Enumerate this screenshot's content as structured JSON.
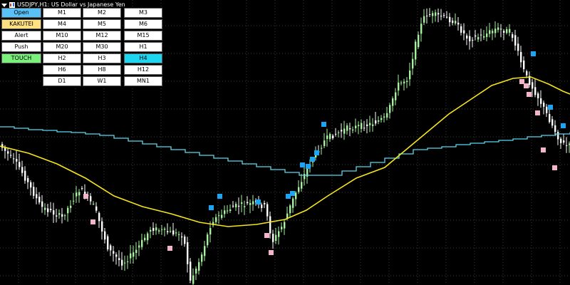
{
  "window": {
    "title": "USDJPY,H1: US Dollar vs Japanese Yen"
  },
  "panel": {
    "left_buttons": [
      {
        "label": "Open",
        "style": "open"
      },
      {
        "label": "KAKUTEI",
        "style": "kakutei"
      },
      {
        "label": "Alert",
        "style": "plain"
      },
      {
        "label": "Push",
        "style": "plain"
      },
      {
        "label": "TOUCH",
        "style": "touch"
      }
    ],
    "timeframes": [
      [
        "M1",
        "M2",
        "M3"
      ],
      [
        "M4",
        "M5",
        "M6"
      ],
      [
        "M10",
        "M12",
        "M15"
      ],
      [
        "M20",
        "M30",
        "H1"
      ],
      [
        "H2",
        "H3",
        "H4"
      ],
      [
        "H6",
        "H8",
        "H12"
      ],
      [
        "D1",
        "W1",
        "MN1"
      ]
    ],
    "active_timeframe": "H4"
  },
  "colors": {
    "background": "#000000",
    "grid": "#3a3a3a",
    "bull_candle": "#a7f0a0",
    "bear_candle": "#ffffff",
    "yellow_ma": "#f5e41b",
    "cyan_line": "#5ad8f0",
    "blue_marker": "#1aa5f5",
    "pink_marker": "#f5b5c8",
    "active_button": "#1fd6f0"
  },
  "icons": [
    "symbol-menu-icon",
    "candle-chart-icon"
  ]
}
